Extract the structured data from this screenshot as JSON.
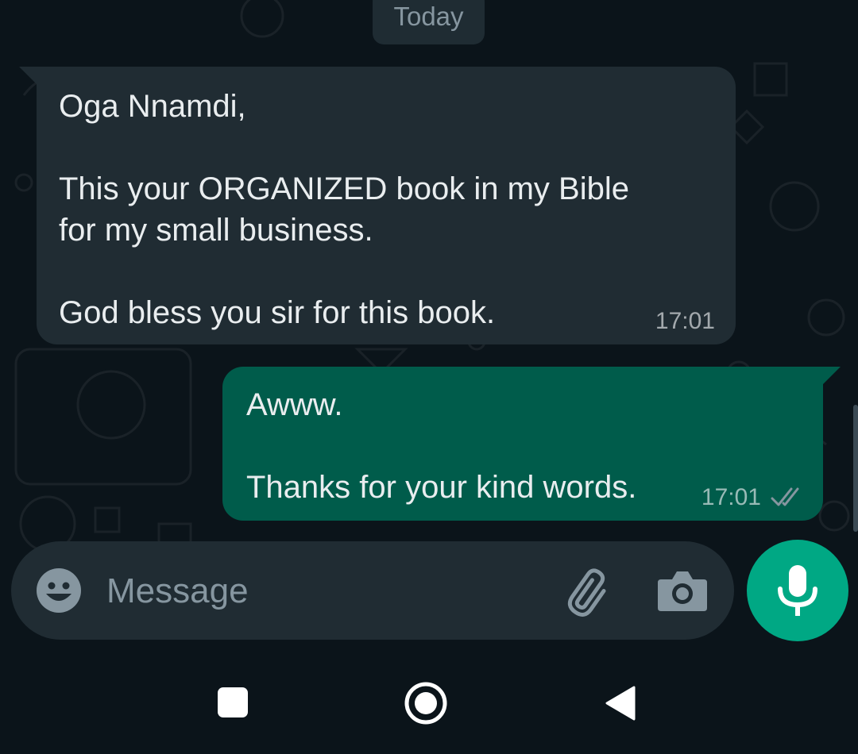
{
  "date_chip": "Today",
  "messages": {
    "incoming": {
      "lines": [
        "Oga Nnamdi,",
        "",
        "This your ORGANIZED book in my Bible",
        "for my small business.",
        "",
        "God bless you sir for this book."
      ],
      "time": "17:01"
    },
    "outgoing": {
      "lines": [
        "Awww.",
        "",
        "Thanks for your kind words."
      ],
      "time": "17:01",
      "status": "read"
    }
  },
  "composer": {
    "placeholder": "Message",
    "emoji_icon": "emoji-icon",
    "attach_icon": "paperclip-icon",
    "camera_icon": "camera-icon",
    "mic_icon": "microphone-icon"
  },
  "navigation": {
    "recents_icon": "square-icon",
    "home_icon": "circle-icon",
    "back_icon": "triangle-back-icon"
  },
  "colors": {
    "background": "#0b141a",
    "incoming_bubble": "#202c33",
    "outgoing_bubble": "#005c4b",
    "accent": "#00a884",
    "text": "#e9edef",
    "muted": "#8696a0"
  }
}
